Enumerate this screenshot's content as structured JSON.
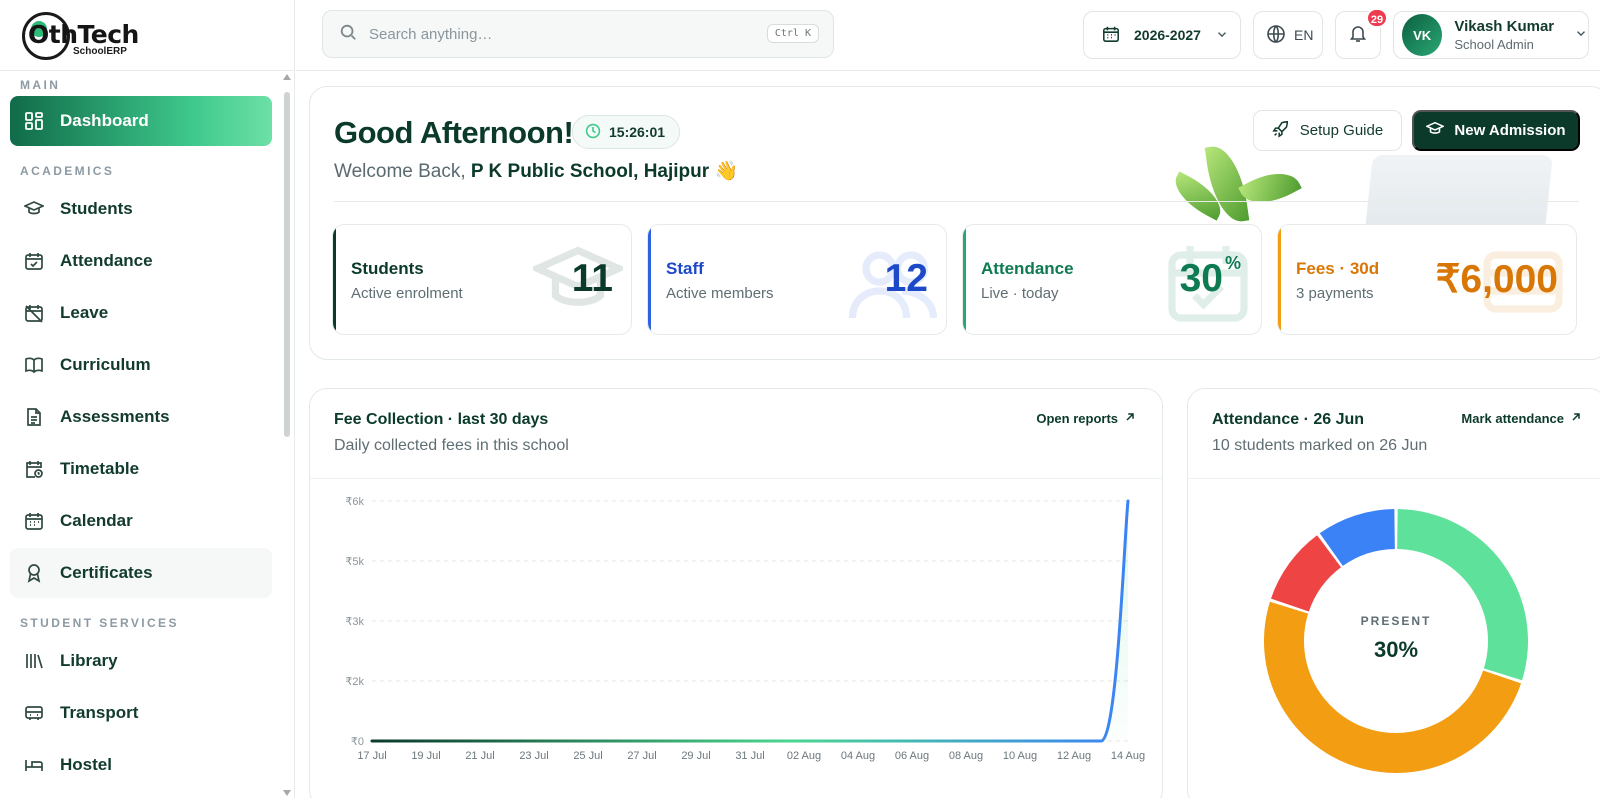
{
  "brand": {
    "name": "OthTech",
    "sub": "SchoolERP"
  },
  "sidebar": {
    "sections": [
      {
        "label": "MAIN"
      },
      {
        "label": "ACADEMICS"
      },
      {
        "label": "STUDENT SERVICES"
      }
    ],
    "items": [
      {
        "label": "Dashboard",
        "icon": "dashboard-icon"
      },
      {
        "label": "Students",
        "icon": "graduation-cap-icon"
      },
      {
        "label": "Attendance",
        "icon": "calendar-check-icon"
      },
      {
        "label": "Leave",
        "icon": "calendar-off-icon"
      },
      {
        "label": "Curriculum",
        "icon": "book-open-icon"
      },
      {
        "label": "Assessments",
        "icon": "document-icon"
      },
      {
        "label": "Timetable",
        "icon": "calendar-clock-icon"
      },
      {
        "label": "Calendar",
        "icon": "calendar-icon"
      },
      {
        "label": "Certificates",
        "icon": "award-icon"
      },
      {
        "label": "Library",
        "icon": "library-icon"
      },
      {
        "label": "Transport",
        "icon": "bus-icon"
      },
      {
        "label": "Hostel",
        "icon": "bed-icon"
      }
    ]
  },
  "topbar": {
    "search_placeholder": "Search anything…",
    "search_shortcut": "Ctrl K",
    "academic_year": "2026-2027",
    "language": "EN",
    "notifications": "29",
    "user": {
      "initials": "VK",
      "name": "Vikash Kumar",
      "role": "School Admin"
    }
  },
  "welcome": {
    "greeting": "Good Afternoon!",
    "time": "15:26:01",
    "sub_prefix": "Welcome Back,",
    "school": "P K Public School, Hajipur",
    "emoji": "👋",
    "setup_label": "Setup Guide",
    "admission_label": "New Admission"
  },
  "stats": [
    {
      "label": "Students",
      "sub": "Active enrolment",
      "value": "11",
      "color": "#0b3a2b"
    },
    {
      "label": "Staff",
      "sub": "Active members",
      "value": "12",
      "color": "#1d49c9"
    },
    {
      "label": "Attendance",
      "sub": "Live · today",
      "value": "30",
      "suffix": "%",
      "color": "#0d7a52"
    },
    {
      "label": "Fees · 30d",
      "sub": "3 payments",
      "value": "₹6,000",
      "color": "#d97706"
    }
  ],
  "fee_card": {
    "title": "Fee Collection · last 30 days",
    "sub": "Daily collected fees in this school",
    "link": "Open reports"
  },
  "attendance_card": {
    "title": "Attendance · 26 Jun",
    "sub": "10 students marked on 26 Jun",
    "link": "Mark attendance",
    "center_label": "PRESENT",
    "center_value": "30%"
  },
  "chart_data": [
    {
      "type": "area",
      "title": "Fee Collection · last 30 days",
      "x": [
        "17 Jul",
        "18 Jul",
        "19 Jul",
        "20 Jul",
        "21 Jul",
        "22 Jul",
        "23 Jul",
        "24 Jul",
        "25 Jul",
        "26 Jul",
        "27 Jul",
        "28 Jul",
        "29 Jul",
        "30 Jul",
        "31 Jul",
        "01 Aug",
        "02 Aug",
        "03 Aug",
        "04 Aug",
        "05 Aug",
        "06 Aug",
        "07 Aug",
        "08 Aug",
        "09 Aug",
        "10 Aug",
        "11 Aug",
        "12 Aug",
        "13 Aug",
        "14 Aug"
      ],
      "xticks": [
        "17 Jul",
        "19 Jul",
        "21 Jul",
        "23 Jul",
        "25 Jul",
        "27 Jul",
        "29 Jul",
        "31 Jul",
        "02 Aug",
        "04 Aug",
        "06 Aug",
        "08 Aug",
        "10 Aug",
        "12 Aug",
        "14 Aug"
      ],
      "values": [
        0,
        0,
        0,
        0,
        0,
        0,
        0,
        0,
        0,
        0,
        0,
        0,
        0,
        0,
        0,
        0,
        0,
        0,
        0,
        0,
        0,
        0,
        0,
        0,
        0,
        0,
        0,
        0,
        6000
      ],
      "yticks": [
        "₹0",
        "₹2k",
        "₹3k",
        "₹5k",
        "₹6k"
      ],
      "ytick_values": [
        0,
        1500,
        3000,
        4500,
        6000
      ],
      "ylim": [
        0,
        6000
      ],
      "grid": true,
      "colors": [
        "#0b3a2b",
        "#4bd690",
        "#3b82f6"
      ]
    },
    {
      "type": "pie",
      "title": "Attendance · 26 Jun",
      "slices": [
        {
          "value": 30,
          "color": "#5ee19a"
        },
        {
          "value": 50,
          "color": "#f29d12"
        },
        {
          "value": 10,
          "color": "#ef4444"
        },
        {
          "value": 10,
          "color": "#3b82f6"
        }
      ]
    }
  ]
}
